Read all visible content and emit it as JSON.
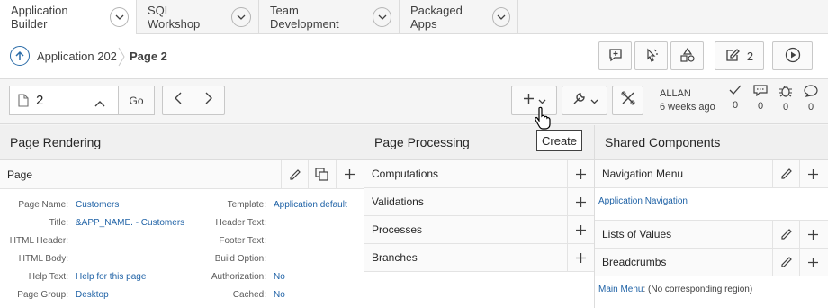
{
  "tabs": [
    {
      "label": "Application Builder",
      "active": true
    },
    {
      "label": "SQL Workshop",
      "active": false
    },
    {
      "label": "Team Development",
      "active": false
    },
    {
      "label": "Packaged Apps",
      "active": false
    }
  ],
  "breadcrumb": {
    "app": "Application 202",
    "page": "Page 2"
  },
  "header_buttons": {
    "edit_count": "2"
  },
  "toolbar": {
    "page_value": "2",
    "go_label": "Go",
    "user": "ALLAN",
    "last_edit": "6 weeks ago",
    "stats": [
      "0",
      "0",
      "0",
      "0"
    ]
  },
  "tooltip": "Create",
  "rendering": {
    "title": "Page Rendering",
    "section": "Page",
    "props_left": [
      {
        "k": "Page Name:",
        "v": "Customers"
      },
      {
        "k": "Title:",
        "v": "&APP_NAME. - Customers"
      },
      {
        "k": "HTML Header:",
        "v": ""
      },
      {
        "k": "HTML Body:",
        "v": ""
      },
      {
        "k": "Help Text:",
        "v": "Help for this page"
      },
      {
        "k": "Page Group:",
        "v": "Desktop"
      }
    ],
    "props_right": [
      {
        "k": "Template:",
        "v": "Application default"
      },
      {
        "k": "Header Text:",
        "v": ""
      },
      {
        "k": "Footer Text:",
        "v": ""
      },
      {
        "k": "Build Option:",
        "v": ""
      },
      {
        "k": "Authorization:",
        "v": "No"
      },
      {
        "k": "Cached:",
        "v": "No"
      }
    ]
  },
  "processing": {
    "title": "Page Processing",
    "rows": [
      "Computations",
      "Validations",
      "Processes",
      "Branches"
    ]
  },
  "shared": {
    "title": "Shared Components",
    "nav_menu": "Navigation Menu",
    "nav_link": "Application Navigation",
    "lov": "Lists of Values",
    "breadcrumbs": "Breadcrumbs",
    "main_menu_link": "Main Menu",
    "main_menu_note": ": (No corresponding region)"
  },
  "colors": {
    "link": "#1f62a6",
    "accent": "#2b6ca8"
  }
}
